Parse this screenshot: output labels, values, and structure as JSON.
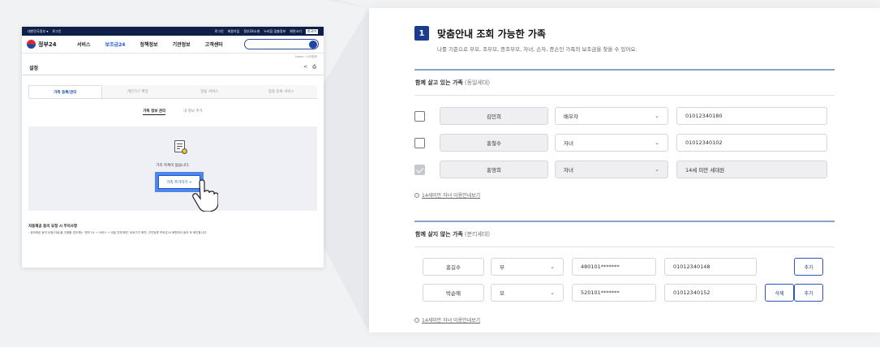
{
  "left_screenshot": {
    "util_bar": {
      "items": [
        "대한민국정부 ▾",
        "로그인"
      ],
      "right_items": [
        "로그인",
        "회원가입",
        "정부24소개",
        "누리집 맞춤정보",
        "화면크기"
      ],
      "highlight": "한국어"
    },
    "logo_text": "정부24",
    "menu": [
      "서비스",
      "보조금24",
      "정책정보",
      "기관정보",
      "고객센터"
    ],
    "active_menu": "보조금24",
    "breadcrumb": "Home › 나의정보",
    "page_title": "설정",
    "tabs": [
      "가족 등록/관리",
      "개인가구 확장",
      "알림 서비스",
      "맞춤 등록 서비스"
    ],
    "subtabs": [
      "가족 정보 관리",
      "내 정보 추가"
    ],
    "empty_text": "가족 목록이 없습니다.",
    "add_button": "가족 추가하기 +",
    "notice_title": "자동제공 동의 요청 시 주의사항",
    "notice_body": "- 정보제공 동의 요청(자료)을 이용할 경우에는 '정보 24 → 서비스 → 내설 전체 확인' 바로가기 화면, 주민등록 보조금24 화면에서 동의 후 확인합니다."
  },
  "right_panel": {
    "section_number": "1",
    "section_title": "맞춤안내 조회 가능한 가족",
    "section_desc": "나를 기준으로 부모, 조부모, 증조부모, 자녀, 손자, 증손인 가족의 보조금을 찾을 수 있어요.",
    "together": {
      "title": "함께 살고 있는 가족",
      "subtitle": "(동일세대)",
      "rows": [
        {
          "name": "김민희",
          "relation": "배우자",
          "phone": "01012340180"
        },
        {
          "name": "홍철수",
          "relation": "자녀",
          "phone": "01012340102"
        },
        {
          "name": "홍영희",
          "relation": "자녀",
          "phone": "14세 미만 세대원"
        }
      ],
      "hint": "14세미만 자녀 이용안내보기"
    },
    "apart": {
      "title": "함께 살지 않는 가족",
      "subtitle": "(분리세대)",
      "rows": [
        {
          "name": "홍길수",
          "relation": "부",
          "rrn": "480101*******",
          "phone": "01012340148",
          "buttons": [
            "추가"
          ]
        },
        {
          "name": "박순애",
          "relation": "모",
          "rrn": "520101*******",
          "phone": "01012340152",
          "buttons": [
            "삭제",
            "추가"
          ]
        }
      ],
      "hint": "14세미만 자녀 이용안내보기"
    }
  },
  "colors": {
    "navy": "#1c3d8f",
    "accent": "#1e56d6",
    "bg": "#f1f2f4"
  }
}
